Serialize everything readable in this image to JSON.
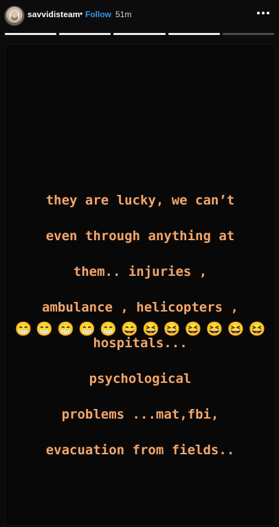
{
  "header": {
    "username": "savvidisteam",
    "separator": "•",
    "follow_label": "Follow",
    "time": "51m",
    "more_icon": "more-options-icon"
  },
  "progress": {
    "segments": 5,
    "completed": 3,
    "active_index": 3
  },
  "story": {
    "text_lines": [
      "they are lucky, we can’t",
      "even through anything at",
      "them.. injuries ,",
      "ambulance , helicopters ,",
      "hospitals...",
      "psychological",
      "problems ...mat,fbi,",
      "evacuation from fields.."
    ],
    "emojis": [
      "😁",
      "😁",
      "😁",
      "😁",
      "😁",
      "😄",
      "😆",
      "😆",
      "😆",
      "😆",
      "😆",
      "😆"
    ],
    "text_color": "#f5a66a",
    "background_color": "#080808"
  }
}
